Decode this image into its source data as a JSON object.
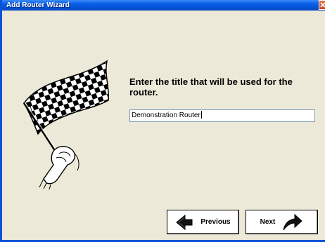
{
  "window": {
    "title": "Add Router Wizard"
  },
  "main": {
    "prompt": "Enter the title that will be used for the router.",
    "title_input_value": "Demonstration Router"
  },
  "buttons": {
    "previous_label": "Previous",
    "next_label": "Next"
  },
  "icons": {
    "title_close": "close-icon",
    "illustration": "checkered-flag-icon",
    "previous": "arrow-left-icon",
    "next": "arrow-right-icon"
  },
  "colors": {
    "titlebar": "#0553d7",
    "background": "#ece9d8",
    "close_button": "#c8421a"
  }
}
